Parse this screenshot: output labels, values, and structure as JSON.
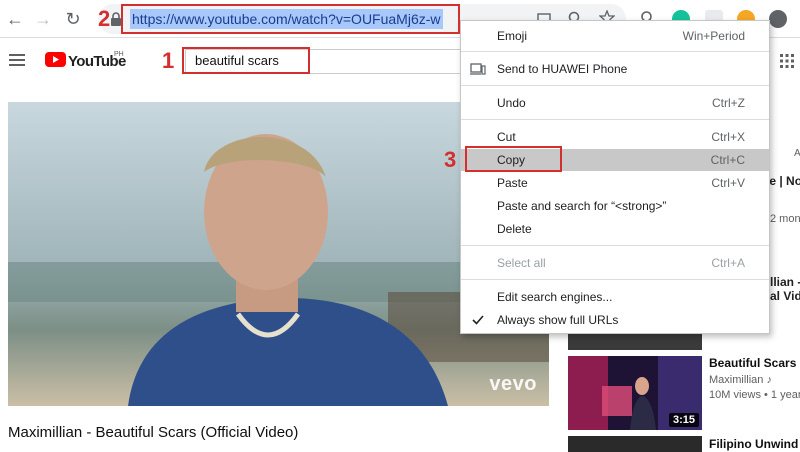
{
  "browser": {
    "url": "https://www.youtube.com/watch?v=OUFuaMj6z-w",
    "back_icon": "arrow-left-icon",
    "forward_icon": "arrow-right-icon",
    "reload_icon": "reload-icon"
  },
  "youtube": {
    "logo_text": "YouTube",
    "region": "PH",
    "search_value": "beautiful scars",
    "video_title": "Maximillian - Beautiful Scars (Official Video)",
    "watermark": "vevo"
  },
  "annotations": {
    "n1": "1",
    "n2": "2",
    "n3": "3",
    "color": "#d32f2f"
  },
  "context_menu": {
    "items": [
      {
        "label": "Emoji",
        "shortcut": "Win+Period"
      },
      {
        "label": "Send to HUAWEI Phone",
        "shortcut": ""
      },
      {
        "label": "Undo",
        "shortcut": "Ctrl+Z"
      },
      {
        "label": "Cut",
        "shortcut": "Ctrl+X"
      },
      {
        "label": "Copy",
        "shortcut": "Ctrl+C"
      },
      {
        "label": "Paste",
        "shortcut": "Ctrl+V"
      },
      {
        "label": "Paste and search for “<strong>”",
        "shortcut": ""
      },
      {
        "label": "Delete",
        "shortcut": ""
      },
      {
        "label": "Select all",
        "shortcut": "Ctrl+A"
      },
      {
        "label": "Edit search engines...",
        "shortcut": ""
      },
      {
        "label": "Always show full URLs",
        "shortcut": ""
      }
    ]
  },
  "sidebar": {
    "clips": [
      {
        "text": "A"
      },
      {
        "text": "ue | No"
      },
      {
        "text": "2 mon"
      },
      {
        "text": "llian -"
      },
      {
        "text": "al Vide"
      }
    ],
    "recs": [
      {
        "title": "Beautiful Scars",
        "channel": "Maximillian ♪",
        "meta": "10M views • 1 year a",
        "duration": "3:15"
      },
      {
        "title": "Filipino Unwind",
        "channel": "",
        "meta": "",
        "duration": ""
      }
    ]
  },
  "colors": {
    "accent": "#d32f2f",
    "selection": "#a8c7fa",
    "menu_highlight": "#c8c8c8",
    "youtube_red": "#ff0000"
  }
}
